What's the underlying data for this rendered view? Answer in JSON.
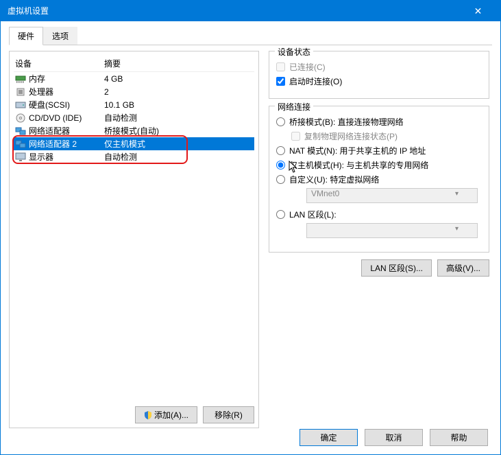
{
  "window": {
    "title": "虚拟机设置"
  },
  "tabs": {
    "hardware": "硬件",
    "options": "选项"
  },
  "headers": {
    "device": "设备",
    "summary": "摘要"
  },
  "devices": [
    {
      "name": "内存",
      "summary": "4 GB",
      "icon": "memory"
    },
    {
      "name": "处理器",
      "summary": "2",
      "icon": "cpu"
    },
    {
      "name": "硬盘(SCSI)",
      "summary": "10.1 GB",
      "icon": "disk"
    },
    {
      "name": "CD/DVD (IDE)",
      "summary": "自动检测",
      "icon": "cd"
    },
    {
      "name": "网络适配器",
      "summary": "桥接模式(自动)",
      "icon": "net"
    },
    {
      "name": "网络适配器 2",
      "summary": "仅主机模式",
      "icon": "net",
      "selected": true
    },
    {
      "name": "显示器",
      "summary": "自动检测",
      "icon": "display"
    }
  ],
  "left_buttons": {
    "add": "添加(A)...",
    "remove": "移除(R)"
  },
  "device_state": {
    "legend": "设备状态",
    "connected": "已连接(C)",
    "connect_at_power_on": "启动时连接(O)",
    "connected_checked": false,
    "connect_at_power_on_checked": true
  },
  "network_conn": {
    "legend": "网络连接",
    "bridged": "桥接模式(B): 直接连接物理网络",
    "replicate": "复制物理网络连接状态(P)",
    "nat": "NAT 模式(N): 用于共享主机的 IP 地址",
    "hostonly": "仅主机模式(H): 与主机共享的专用网络",
    "custom": "自定义(U): 特定虚拟网络",
    "custom_value": "VMnet0",
    "lan": "LAN 区段(L):",
    "lan_value": "",
    "selected": "hostonly"
  },
  "right_buttons": {
    "lan_segments": "LAN 区段(S)...",
    "advanced": "高级(V)..."
  },
  "bottom": {
    "ok": "确定",
    "cancel": "取消",
    "help": "帮助"
  }
}
